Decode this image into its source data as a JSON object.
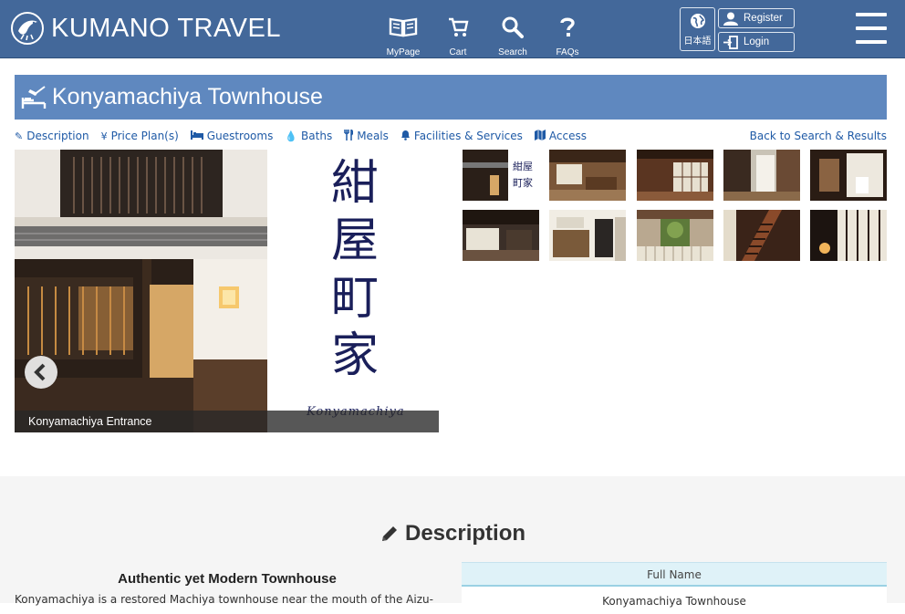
{
  "header": {
    "logo_text": "KUMANO TRAVEL",
    "nav": [
      {
        "label": "MyPage",
        "icon": "book-icon"
      },
      {
        "label": "Cart",
        "icon": "cart-icon"
      },
      {
        "label": "Search",
        "icon": "search-icon"
      },
      {
        "label": "FAQs",
        "icon": "question-icon"
      }
    ],
    "language_label": "日本語",
    "register_label": "Register",
    "login_label": "Login"
  },
  "page": {
    "title": "Konyamachiya Townhouse"
  },
  "subnav": {
    "items": [
      {
        "label": "Description",
        "icon": "pencil-icon"
      },
      {
        "label": "Price Plan(s)",
        "icon": "yen-icon"
      },
      {
        "label": "Guestrooms",
        "icon": "bed-icon"
      },
      {
        "label": "Baths",
        "icon": "drop-icon"
      },
      {
        "label": "Meals",
        "icon": "utensils-icon"
      },
      {
        "label": "Facilities & Services",
        "icon": "bell-icon"
      },
      {
        "label": "Access",
        "icon": "map-icon"
      }
    ],
    "back_label": "Back to Search & Results"
  },
  "gallery": {
    "caption": "Konyamachiya Entrance",
    "kanji": [
      "紺",
      "屋",
      "町",
      "家"
    ],
    "romaji": "Konyamachiya",
    "thumbnail_count": 10
  },
  "description": {
    "heading": "Description",
    "subheading": "Authentic yet Modern Townhouse",
    "body": "Konyamachiya is a restored Machiya townhouse near the mouth of the Aizu-",
    "table_header": "Full Name",
    "table_value": "Konyamachiya Townhouse"
  },
  "colors": {
    "header_bg": "#43689a",
    "title_bg": "#5f88bf",
    "link": "#1f5aa6",
    "section_bg": "#f5f5f5",
    "table_header_bg": "#dff2f8"
  }
}
